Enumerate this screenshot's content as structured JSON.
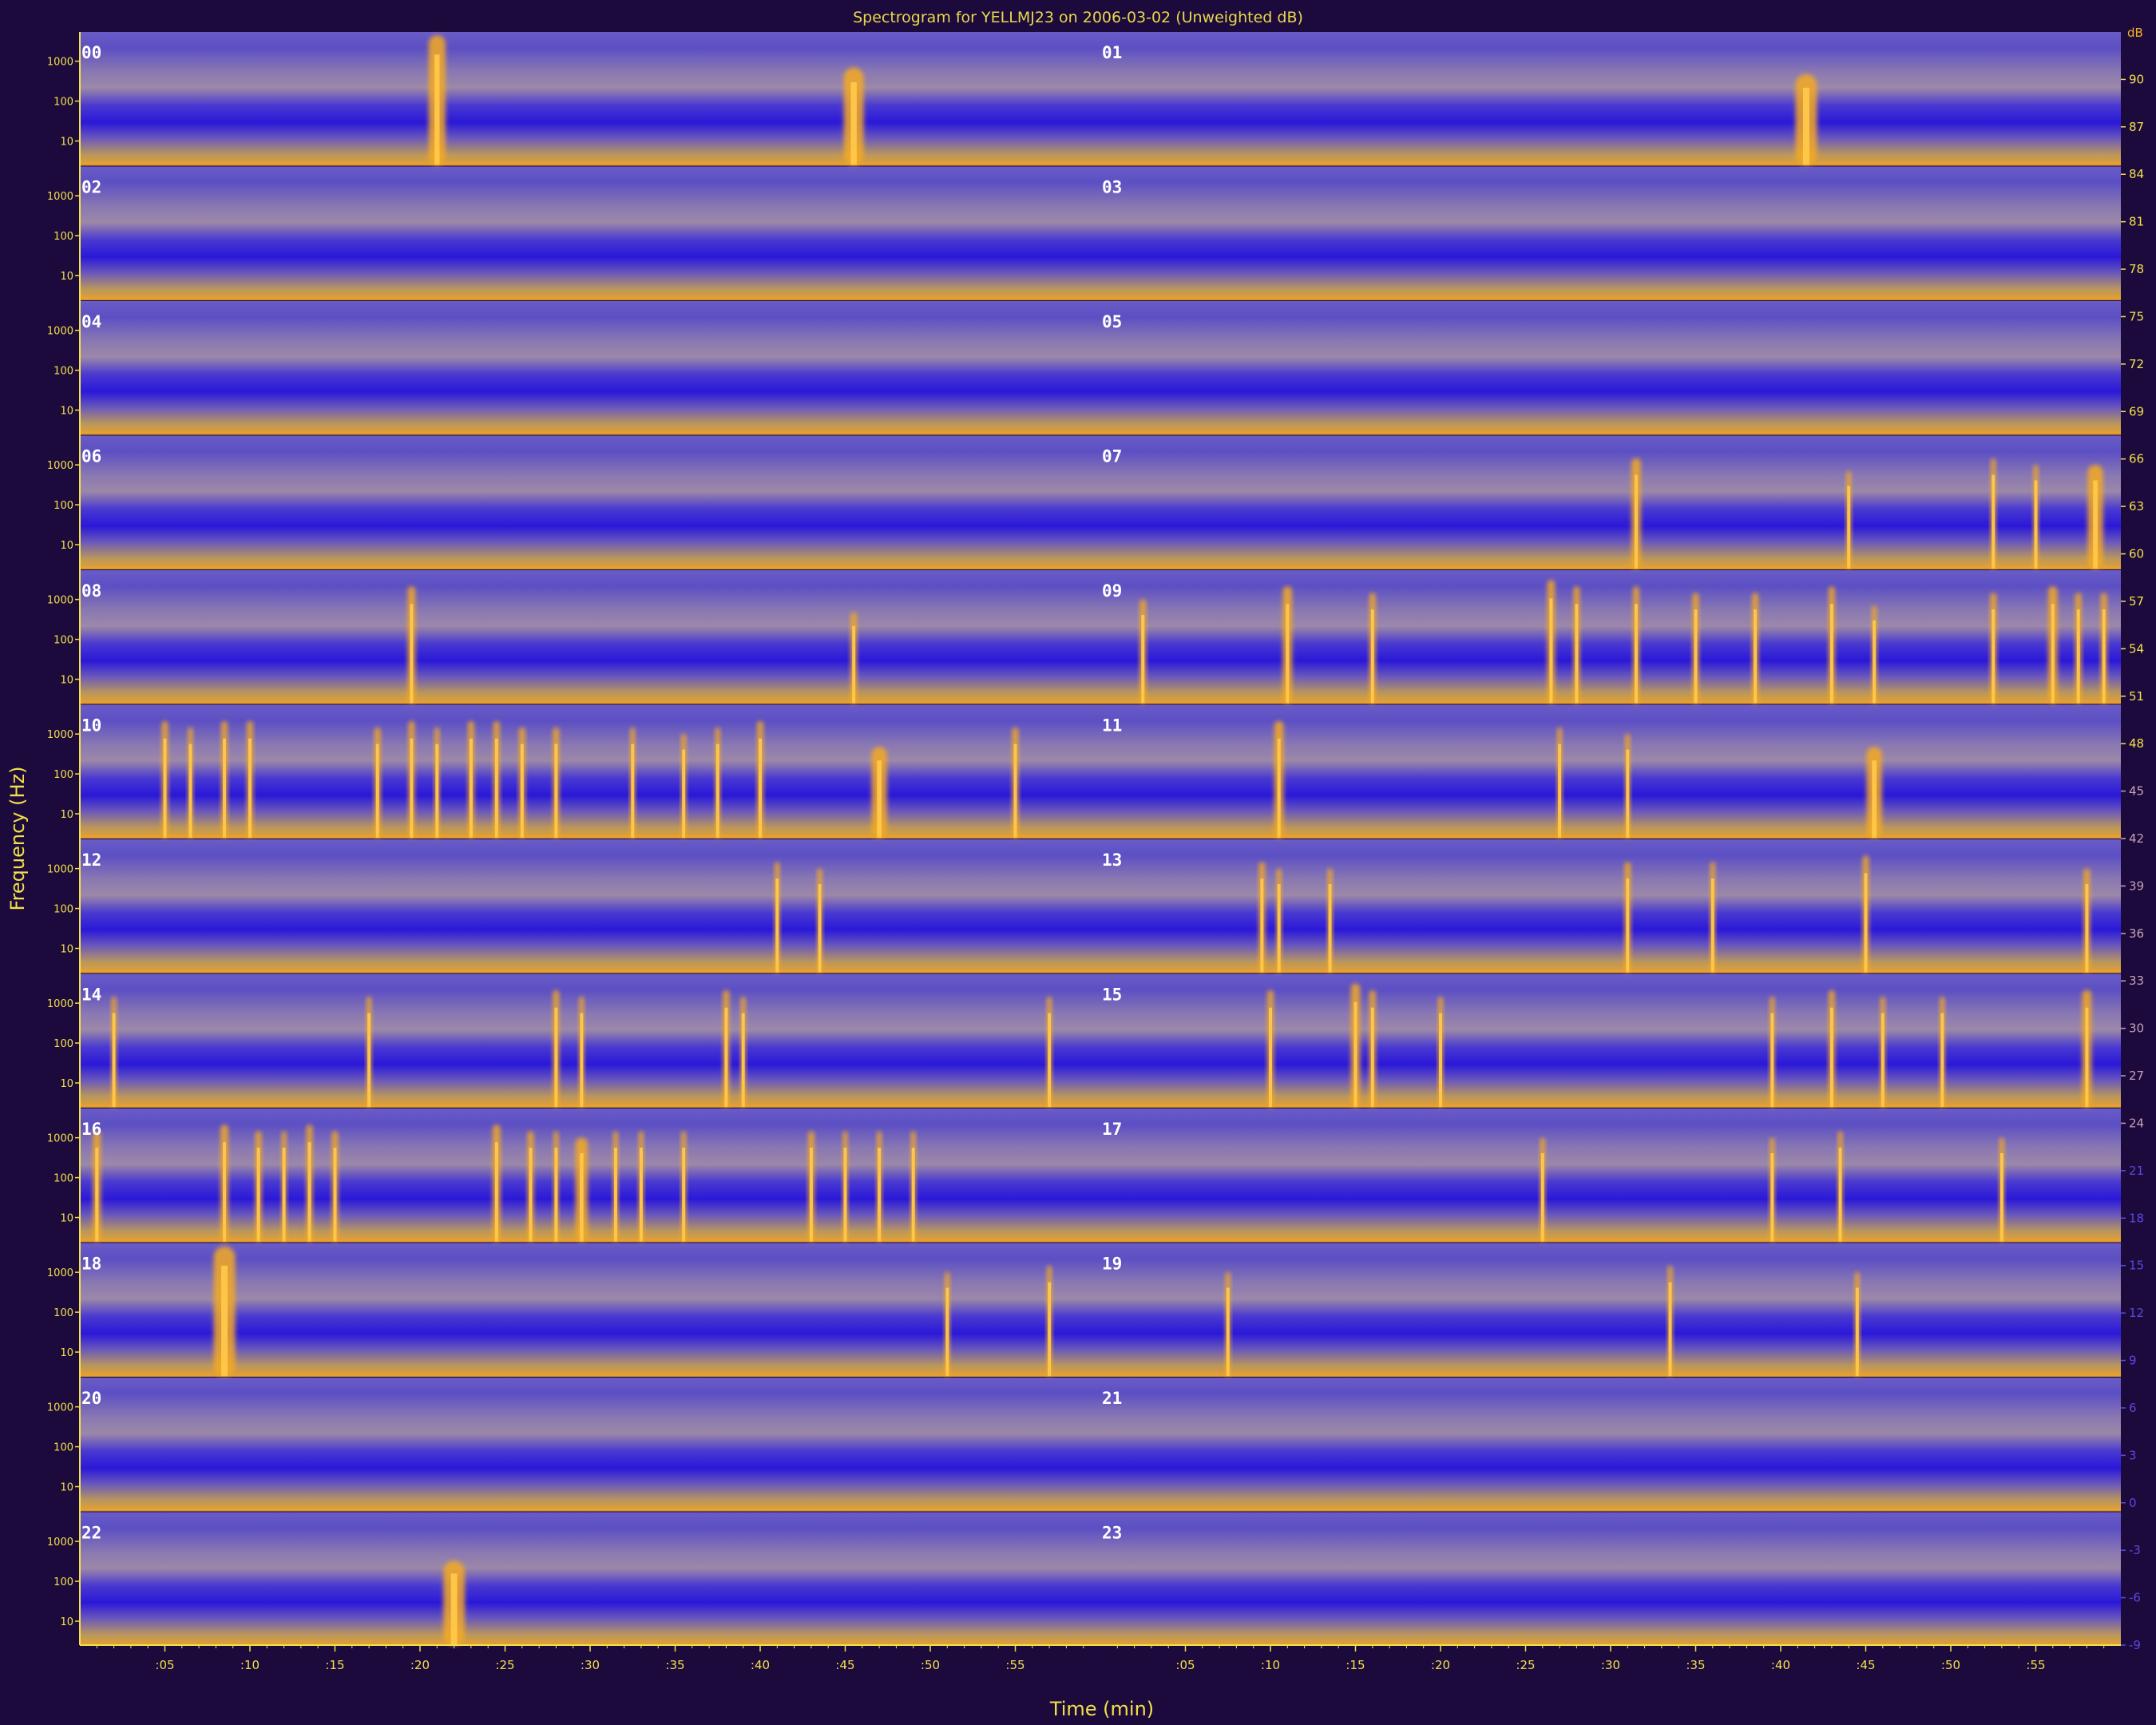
{
  "chart_data": {
    "type": "heatmap",
    "title": "Spectrogram for YELLMJ23 on 2006-03-02 (Unweighted dB)",
    "xlabel": "Time (min)",
    "ylabel": "Frequency (Hz)",
    "y_scale": "log",
    "y_tick_labels": [
      "1000",
      "100",
      "10"
    ],
    "x_tick_labels": [
      ":05",
      ":10",
      ":15",
      ":20",
      ":25",
      ":30",
      ":35",
      ":40",
      ":45",
      ":50",
      ":55"
    ],
    "panel_labels": [
      "00",
      "01",
      "02",
      "03",
      "04",
      "05",
      "06",
      "07",
      "08",
      "09",
      "10",
      "11",
      "12",
      "13",
      "14",
      "15",
      "16",
      "17",
      "18",
      "19",
      "20",
      "21",
      "22",
      "23"
    ],
    "colorbar": {
      "unit_label": "dB",
      "range": [
        -9,
        93
      ],
      "tick_values": [
        90,
        87,
        84,
        81,
        78,
        75,
        72,
        69,
        66,
        63,
        60,
        57,
        54,
        51,
        48,
        45,
        42,
        39,
        36,
        33,
        30,
        27,
        24,
        21,
        18,
        15,
        12,
        9,
        6,
        3,
        0,
        -3,
        -6,
        -9
      ],
      "low_color": "#2c14d2",
      "mid_color": "#5a50b4",
      "high_color": "#f5a820"
    },
    "events": [
      {
        "hour": "00",
        "minute": 21.0,
        "strength": 1.0,
        "width": 1.1
      },
      {
        "hour": "00",
        "minute": 45.5,
        "strength": 0.75,
        "width": 1.3
      },
      {
        "hour": "01",
        "minute": 41.5,
        "strength": 0.7,
        "width": 1.4
      },
      {
        "hour": "07",
        "minute": 31.5,
        "strength": 0.85,
        "width": 0.6
      },
      {
        "hour": "07",
        "minute": 44.0,
        "strength": 0.75,
        "width": 0.3
      },
      {
        "hour": "07",
        "minute": 52.5,
        "strength": 0.85,
        "width": 0.3
      },
      {
        "hour": "07",
        "minute": 55.0,
        "strength": 0.8,
        "width": 0.3
      },
      {
        "hour": "07",
        "minute": 58.5,
        "strength": 0.8,
        "width": 1.0
      },
      {
        "hour": "08",
        "minute": 19.5,
        "strength": 0.9,
        "width": 0.5
      },
      {
        "hour": "08",
        "minute": 45.5,
        "strength": 0.7,
        "width": 0.4
      },
      {
        "hour": "09",
        "minute": 2.5,
        "strength": 0.8,
        "width": 0.4
      },
      {
        "hour": "09",
        "minute": 11.0,
        "strength": 0.9,
        "width": 0.6
      },
      {
        "hour": "09",
        "minute": 16.0,
        "strength": 0.85,
        "width": 0.4
      },
      {
        "hour": "09",
        "minute": 26.5,
        "strength": 0.95,
        "width": 0.5
      },
      {
        "hour": "09",
        "minute": 28.0,
        "strength": 0.9,
        "width": 0.4
      },
      {
        "hour": "09",
        "minute": 31.5,
        "strength": 0.9,
        "width": 0.4
      },
      {
        "hour": "09",
        "minute": 35.0,
        "strength": 0.85,
        "width": 0.4
      },
      {
        "hour": "09",
        "minute": 38.5,
        "strength": 0.85,
        "width": 0.4
      },
      {
        "hour": "09",
        "minute": 43.0,
        "strength": 0.9,
        "width": 0.4
      },
      {
        "hour": "09",
        "minute": 45.5,
        "strength": 0.75,
        "width": 0.3
      },
      {
        "hour": "09",
        "minute": 52.5,
        "strength": 0.85,
        "width": 0.4
      },
      {
        "hour": "09",
        "minute": 56.0,
        "strength": 0.9,
        "width": 0.6
      },
      {
        "hour": "09",
        "minute": 57.5,
        "strength": 0.85,
        "width": 0.4
      },
      {
        "hour": "09",
        "minute": 59.0,
        "strength": 0.85,
        "width": 0.4
      },
      {
        "hour": "10",
        "minute": 5.0,
        "strength": 0.9,
        "width": 0.4
      },
      {
        "hour": "10",
        "minute": 6.5,
        "strength": 0.85,
        "width": 0.3
      },
      {
        "hour": "10",
        "minute": 8.5,
        "strength": 0.9,
        "width": 0.4
      },
      {
        "hour": "10",
        "minute": 10.0,
        "strength": 0.9,
        "width": 0.4
      },
      {
        "hour": "10",
        "minute": 17.5,
        "strength": 0.85,
        "width": 0.4
      },
      {
        "hour": "10",
        "minute": 19.5,
        "strength": 0.9,
        "width": 0.4
      },
      {
        "hour": "10",
        "minute": 21.0,
        "strength": 0.85,
        "width": 0.3
      },
      {
        "hour": "10",
        "minute": 23.0,
        "strength": 0.9,
        "width": 0.4
      },
      {
        "hour": "10",
        "minute": 24.5,
        "strength": 0.9,
        "width": 0.4
      },
      {
        "hour": "10",
        "minute": 26.0,
        "strength": 0.85,
        "width": 0.4
      },
      {
        "hour": "10",
        "minute": 28.0,
        "strength": 0.85,
        "width": 0.4
      },
      {
        "hour": "10",
        "minute": 32.5,
        "strength": 0.85,
        "width": 0.3
      },
      {
        "hour": "10",
        "minute": 35.5,
        "strength": 0.8,
        "width": 0.3
      },
      {
        "hour": "10",
        "minute": 37.5,
        "strength": 0.85,
        "width": 0.3
      },
      {
        "hour": "10",
        "minute": 40.0,
        "strength": 0.9,
        "width": 0.4
      },
      {
        "hour": "10",
        "minute": 47.0,
        "strength": 0.7,
        "width": 1.0
      },
      {
        "hour": "10",
        "minute": 55.0,
        "strength": 0.85,
        "width": 0.4
      },
      {
        "hour": "11",
        "minute": 10.5,
        "strength": 0.9,
        "width": 0.6
      },
      {
        "hour": "11",
        "minute": 27.0,
        "strength": 0.85,
        "width": 0.3
      },
      {
        "hour": "11",
        "minute": 31.0,
        "strength": 0.8,
        "width": 0.3
      },
      {
        "hour": "11",
        "minute": 45.5,
        "strength": 0.7,
        "width": 1.0
      },
      {
        "hour": "12",
        "minute": 41.0,
        "strength": 0.85,
        "width": 0.3
      },
      {
        "hour": "12",
        "minute": 43.5,
        "strength": 0.8,
        "width": 0.3
      },
      {
        "hour": "13",
        "minute": 9.5,
        "strength": 0.85,
        "width": 0.4
      },
      {
        "hour": "13",
        "minute": 10.5,
        "strength": 0.8,
        "width": 0.3
      },
      {
        "hour": "13",
        "minute": 13.5,
        "strength": 0.8,
        "width": 0.3
      },
      {
        "hour": "13",
        "minute": 31.0,
        "strength": 0.85,
        "width": 0.4
      },
      {
        "hour": "13",
        "minute": 36.0,
        "strength": 0.85,
        "width": 0.3
      },
      {
        "hour": "13",
        "minute": 45.0,
        "strength": 0.9,
        "width": 0.4
      },
      {
        "hour": "13",
        "minute": 58.0,
        "strength": 0.8,
        "width": 0.4
      },
      {
        "hour": "14",
        "minute": 2.0,
        "strength": 0.85,
        "width": 0.3
      },
      {
        "hour": "14",
        "minute": 17.0,
        "strength": 0.85,
        "width": 0.3
      },
      {
        "hour": "14",
        "minute": 28.0,
        "strength": 0.9,
        "width": 0.4
      },
      {
        "hour": "14",
        "minute": 29.5,
        "strength": 0.85,
        "width": 0.3
      },
      {
        "hour": "14",
        "minute": 38.0,
        "strength": 0.9,
        "width": 0.4
      },
      {
        "hour": "14",
        "minute": 39.0,
        "strength": 0.85,
        "width": 0.3
      },
      {
        "hour": "14",
        "minute": 57.0,
        "strength": 0.85,
        "width": 0.3
      },
      {
        "hour": "15",
        "minute": 10.0,
        "strength": 0.9,
        "width": 0.4
      },
      {
        "hour": "15",
        "minute": 15.0,
        "strength": 0.95,
        "width": 0.6
      },
      {
        "hour": "15",
        "minute": 16.0,
        "strength": 0.9,
        "width": 0.4
      },
      {
        "hour": "15",
        "minute": 20.0,
        "strength": 0.85,
        "width": 0.3
      },
      {
        "hour": "15",
        "minute": 39.5,
        "strength": 0.85,
        "width": 0.3
      },
      {
        "hour": "15",
        "minute": 43.0,
        "strength": 0.9,
        "width": 0.4
      },
      {
        "hour": "15",
        "minute": 46.0,
        "strength": 0.85,
        "width": 0.3
      },
      {
        "hour": "15",
        "minute": 49.5,
        "strength": 0.85,
        "width": 0.3
      },
      {
        "hour": "15",
        "minute": 58.0,
        "strength": 0.9,
        "width": 0.6
      },
      {
        "hour": "16",
        "minute": 1.0,
        "strength": 0.85,
        "width": 0.5
      },
      {
        "hour": "16",
        "minute": 8.5,
        "strength": 0.9,
        "width": 0.5
      },
      {
        "hour": "16",
        "minute": 10.5,
        "strength": 0.85,
        "width": 0.4
      },
      {
        "hour": "16",
        "minute": 12.0,
        "strength": 0.85,
        "width": 0.3
      },
      {
        "hour": "16",
        "minute": 13.5,
        "strength": 0.9,
        "width": 0.4
      },
      {
        "hour": "16",
        "minute": 15.0,
        "strength": 0.85,
        "width": 0.4
      },
      {
        "hour": "16",
        "minute": 24.5,
        "strength": 0.9,
        "width": 0.5
      },
      {
        "hour": "16",
        "minute": 26.5,
        "strength": 0.85,
        "width": 0.4
      },
      {
        "hour": "16",
        "minute": 28.0,
        "strength": 0.85,
        "width": 0.3
      },
      {
        "hour": "16",
        "minute": 29.5,
        "strength": 0.8,
        "width": 0.8
      },
      {
        "hour": "16",
        "minute": 31.5,
        "strength": 0.85,
        "width": 0.3
      },
      {
        "hour": "16",
        "minute": 33.0,
        "strength": 0.85,
        "width": 0.3
      },
      {
        "hour": "16",
        "minute": 35.5,
        "strength": 0.85,
        "width": 0.3
      },
      {
        "hour": "16",
        "minute": 43.0,
        "strength": 0.85,
        "width": 0.4
      },
      {
        "hour": "16",
        "minute": 45.0,
        "strength": 0.85,
        "width": 0.3
      },
      {
        "hour": "16",
        "minute": 47.0,
        "strength": 0.85,
        "width": 0.3
      },
      {
        "hour": "16",
        "minute": 49.0,
        "strength": 0.85,
        "width": 0.3
      },
      {
        "hour": "17",
        "minute": 26.0,
        "strength": 0.8,
        "width": 0.3
      },
      {
        "hour": "17",
        "minute": 39.5,
        "strength": 0.8,
        "width": 0.3
      },
      {
        "hour": "17",
        "minute": 43.5,
        "strength": 0.85,
        "width": 0.3
      },
      {
        "hour": "17",
        "minute": 53.0,
        "strength": 0.8,
        "width": 0.3
      },
      {
        "hour": "18",
        "minute": 8.5,
        "strength": 1.0,
        "width": 1.4
      },
      {
        "hour": "18",
        "minute": 51.0,
        "strength": 0.8,
        "width": 0.3
      },
      {
        "hour": "18",
        "minute": 57.0,
        "strength": 0.85,
        "width": 0.3
      },
      {
        "hour": "19",
        "minute": 7.5,
        "strength": 0.8,
        "width": 0.3
      },
      {
        "hour": "19",
        "minute": 33.5,
        "strength": 0.85,
        "width": 0.3
      },
      {
        "hour": "19",
        "minute": 44.5,
        "strength": 0.8,
        "width": 0.3
      },
      {
        "hour": "22",
        "minute": 22.0,
        "strength": 0.65,
        "width": 1.4
      }
    ]
  }
}
